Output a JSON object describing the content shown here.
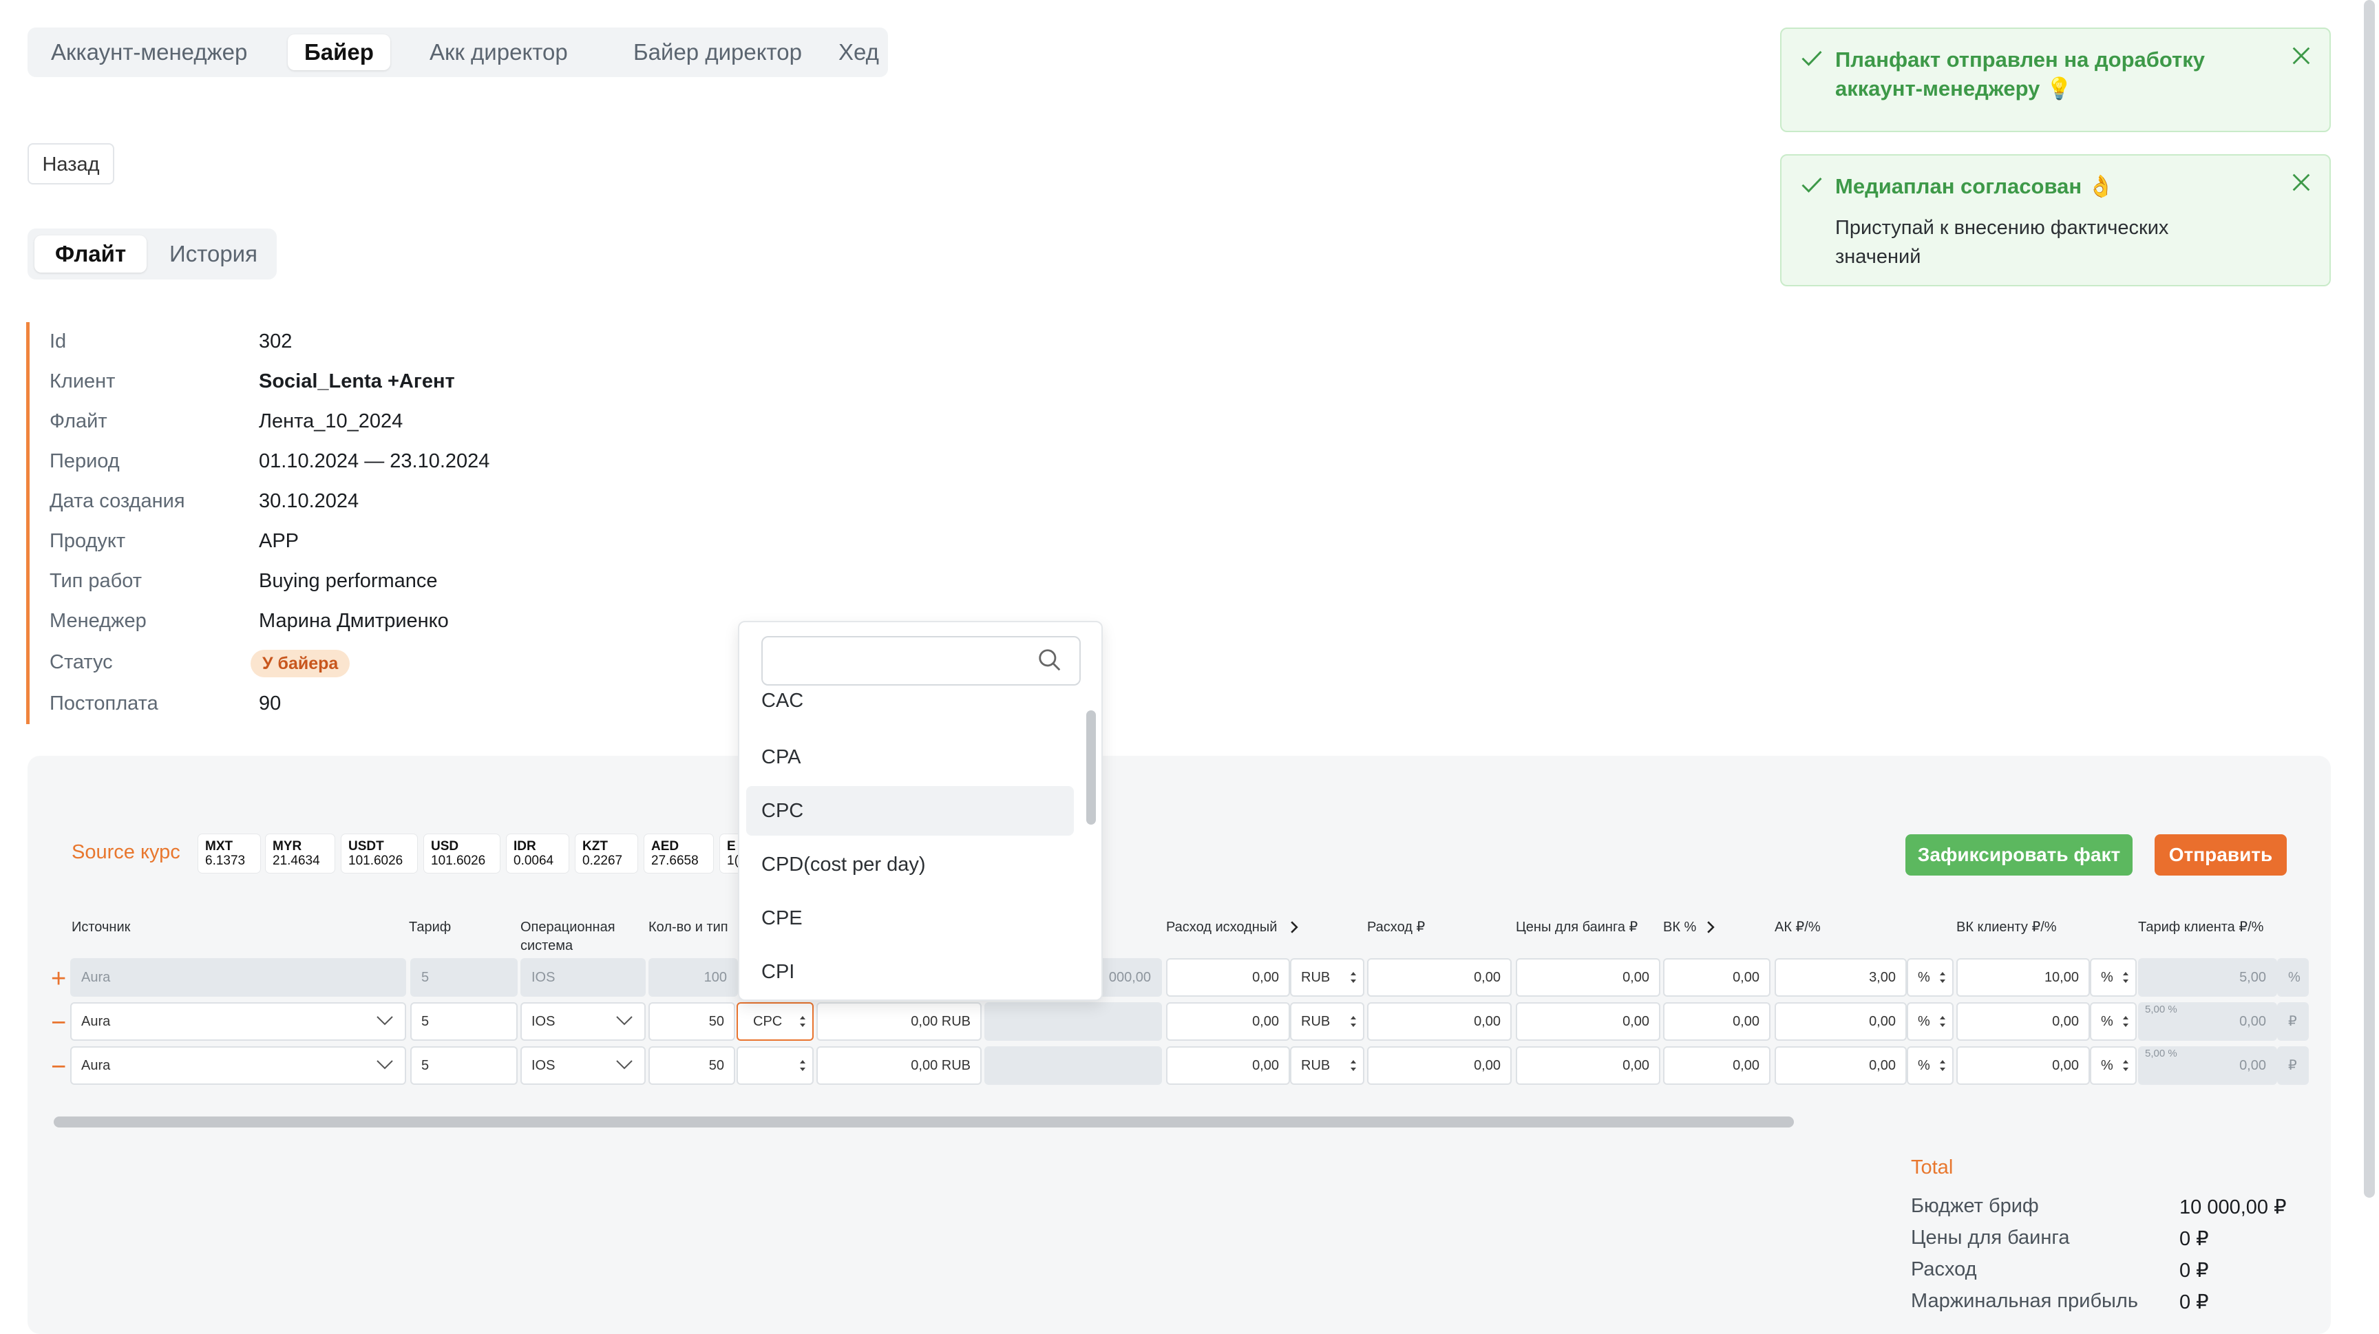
{
  "role_tabs": [
    "Аккаунт-менеджер",
    "Байер",
    "Акк директор",
    "Байер директор",
    "Хед"
  ],
  "active_role": "Байер",
  "back_label": "Назад",
  "sub_tabs": [
    "Флайт",
    "История"
  ],
  "info": [
    {
      "label": "Id",
      "value": "302"
    },
    {
      "label": "Клиент",
      "value": "Social_Lenta +Агент"
    },
    {
      "label": "Флайт",
      "value": "Лента_10_2024"
    },
    {
      "label": "Период",
      "value": "01.10.2024 — 23.10.2024"
    },
    {
      "label": "Дата создания",
      "value": "30.10.2024"
    },
    {
      "label": "Продукт",
      "value": "APP"
    },
    {
      "label": "Тип работ",
      "value": "Buying performance"
    },
    {
      "label": "Менеджер",
      "value": "Марина Дмитриенко"
    },
    {
      "label": "Статус",
      "value": "У байера"
    },
    {
      "label": "Постоплата",
      "value": "90"
    }
  ],
  "toasts": [
    {
      "title": "Планфакт отправлен на доработку аккаунт-менеджеру 💡",
      "title_line1": "Планфакт отправлен на доработку",
      "title_line2": "аккаунт-менеджеру 💡",
      "body_line1": "",
      "body_line2": ""
    },
    {
      "title_line1": "Медиаплан согласован 👌",
      "title_line2": "",
      "body_line1": "Приступай к внесению фактических",
      "body_line2": "значений"
    }
  ],
  "source_label": "Source курс",
  "rates": [
    {
      "code": "MXT",
      "value": "6.1373"
    },
    {
      "code": "MYR",
      "value": "21.4634"
    },
    {
      "code": "USDT",
      "value": "101.6026"
    },
    {
      "code": "USD",
      "value": "101.6026"
    },
    {
      "code": "IDR",
      "value": "0.0064"
    },
    {
      "code": "KZT",
      "value": "0.2267"
    },
    {
      "code": "AED",
      "value": "27.6658"
    },
    {
      "code": "E",
      "value": "1("
    }
  ],
  "buttons": {
    "fix": "Зафиксировать факт",
    "send": "Отправить"
  },
  "columns": {
    "source": "Источник",
    "tariff": "Тариф",
    "os_1": "Операционная",
    "os_2": "система",
    "qty": "Кол-во и тип",
    "spend_src": "Расход исходный",
    "spend_rub": "Расход ₽",
    "buy_price": "Цены для баинга ₽",
    "vk": "ВК %",
    "ak": "АК ₽/%",
    "vk_client": "ВК клиенту ₽/%",
    "client_tariff": "Тариф клиента ₽/%"
  },
  "rows": [
    {
      "mark": "+",
      "source": "Aura",
      "tariff": "5",
      "os": "IOS",
      "qty": "100",
      "type": "",
      "budget": "",
      "col7": "000,00",
      "spend_src": "0,00",
      "currency": "RUB",
      "spend_rub": "0,00",
      "buy_price": "0,00",
      "vk": "0,00",
      "ak": "3,00",
      "ak_unit": "%",
      "vk_client": "10,00",
      "vk_unit": "%",
      "client_tariff": "5,00",
      "ct_unit": "%",
      "ct_hint": ""
    },
    {
      "mark": "−",
      "source": "Aura",
      "tariff": "5",
      "os": "IOS",
      "qty": "50",
      "type": "CPC",
      "budget": "0,00 RUB",
      "col7": "",
      "spend_src": "0,00",
      "currency": "RUB",
      "spend_rub": "0,00",
      "buy_price": "0,00",
      "vk": "0,00",
      "ak": "0,00",
      "ak_unit": "%",
      "vk_client": "0,00",
      "vk_unit": "%",
      "client_tariff": "0,00",
      "ct_unit": "₽",
      "ct_hint": "5,00 %"
    },
    {
      "mark": "−",
      "source": "Aura",
      "tariff": "5",
      "os": "IOS",
      "qty": "50",
      "type": "",
      "budget": "0,00 RUB",
      "col7": "",
      "spend_src": "0,00",
      "currency": "RUB",
      "spend_rub": "0,00",
      "buy_price": "0,00",
      "vk": "0,00",
      "ak": "0,00",
      "ak_unit": "%",
      "vk_client": "0,00",
      "vk_unit": "%",
      "client_tariff": "0,00",
      "ct_unit": "₽",
      "ct_hint": "5,00 %"
    }
  ],
  "dropdown": {
    "search_value": "",
    "options": [
      "CAC",
      "CPA",
      "CPC",
      "CPD(cost per day)",
      "CPE",
      "CPI"
    ],
    "selected": "CPC"
  },
  "total": {
    "title": "Total",
    "items": [
      {
        "label": "Бюджет бриф",
        "value": "10 000,00 ₽"
      },
      {
        "label": "Цены для баинга",
        "value": "0 ₽"
      },
      {
        "label": "Расход",
        "value": "0 ₽"
      },
      {
        "label": "Маржинальная прибыль",
        "value": "0 ₽"
      }
    ]
  },
  "colors": {
    "accent": "#e8772e",
    "success": "#5cb85f",
    "send": "#ea6f2d"
  }
}
